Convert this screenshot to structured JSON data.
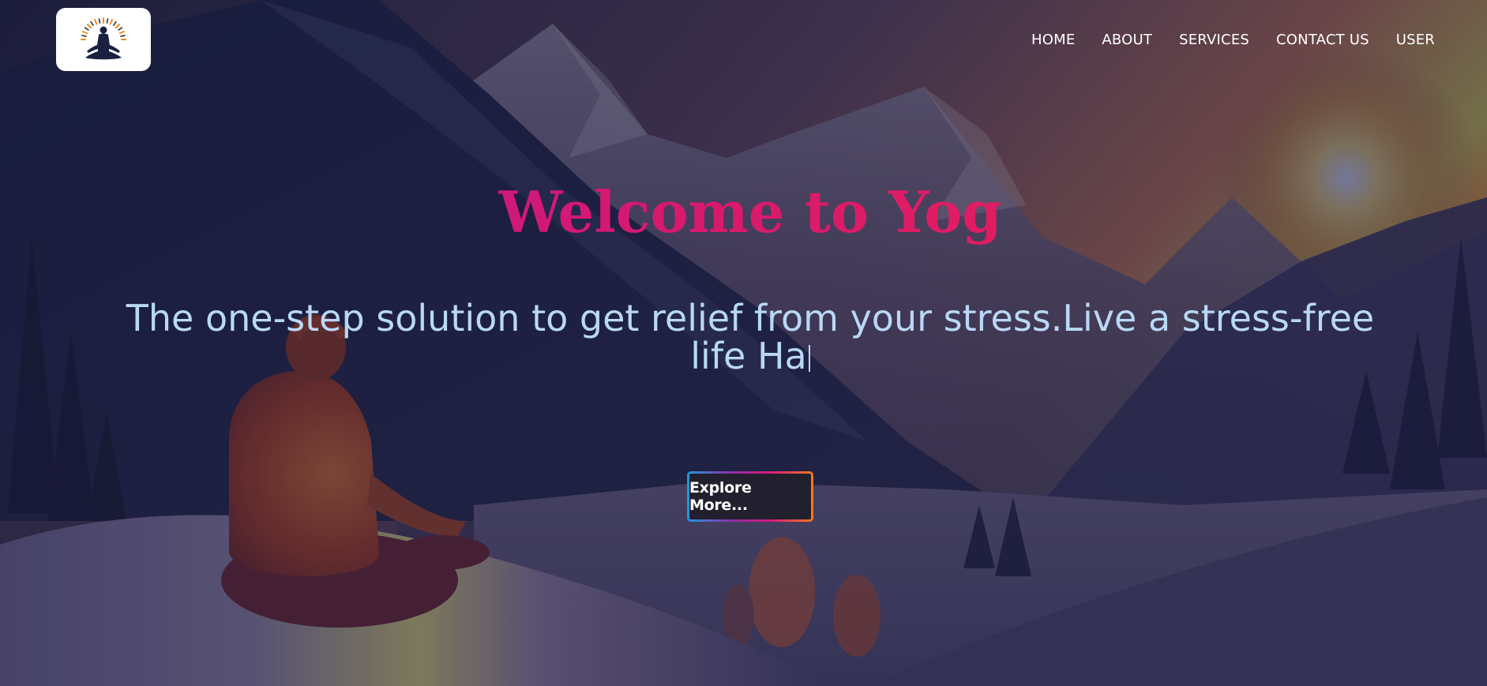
{
  "nav": {
    "logo_icon": "meditation-figure-icon",
    "items": [
      {
        "label": "HOME"
      },
      {
        "label": "ABOUT"
      },
      {
        "label": "SERVICES"
      },
      {
        "label": "CONTACT US"
      },
      {
        "label": "USER"
      }
    ]
  },
  "hero": {
    "title": "Welcome to Yog",
    "subtitle": "The one-step solution to get relief from your stress.Live a stress-free life Ha",
    "cta_label": "Explore More..."
  },
  "colors": {
    "title_gradient": [
      "#b3199c",
      "#d8196e",
      "#ee2350"
    ],
    "subtitle": "#b9d8f6",
    "button_border_gradient": [
      "#1e9bd8",
      "#8e2ea8",
      "#d6197c",
      "#f27a1f"
    ],
    "button_bg": "#22202e"
  },
  "background": {
    "scene": "person-meditating-in-snowy-mountains-image"
  }
}
